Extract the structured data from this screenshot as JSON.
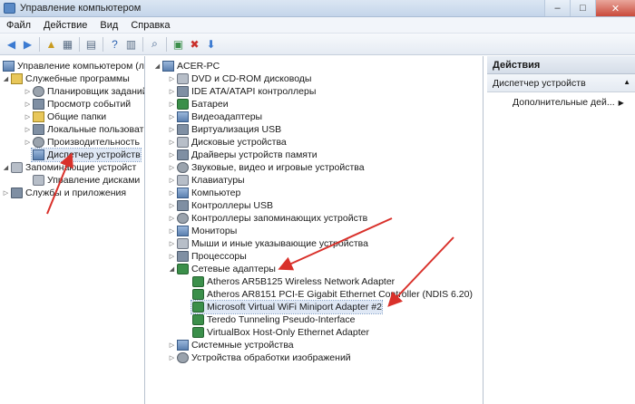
{
  "window": {
    "title": "Управление компьютером",
    "minimize": "–",
    "maximize": "□",
    "close": "✕"
  },
  "menu": [
    "Файл",
    "Действие",
    "Вид",
    "Справка"
  ],
  "left_tree": {
    "root": "Управление компьютером (л",
    "system_tools": "Служебные программы",
    "task_scheduler": "Планировщик заданий",
    "event_viewer": "Просмотр событий",
    "shared_folders": "Общие папки",
    "local_users": "Локальные пользоват",
    "performance": "Производительность",
    "device_manager": "Диспетчер устройств",
    "storage": "Запоминающие устройст",
    "disk_management": "Управление дисками",
    "services_apps": "Службы и приложения"
  },
  "device_tree": {
    "root": "ACER-PC",
    "categories": [
      "DVD и CD-ROM дисководы",
      "IDE ATA/ATAPI контроллеры",
      "Батареи",
      "Видеоадаптеры",
      "Виртуализация USB",
      "Дисковые устройства",
      "Драйверы устройств памяти",
      "Звуковые, видео и игровые устройства",
      "Клавиатуры",
      "Компьютер",
      "Контроллеры USB",
      "Контроллеры запоминающих устройств",
      "Мониторы",
      "Мыши и иные указывающие устройства",
      "Процессоры",
      "Сетевые адаптеры"
    ],
    "network_adapters": [
      "Atheros AR5B125 Wireless Network Adapter",
      "Atheros AR8151 PCI-E Gigabit Ethernet Controller (NDIS 6.20)",
      "Microsoft Virtual WiFi Miniport Adapter #2",
      "Teredo Tunneling Pseudo-Interface",
      "VirtualBox Host-Only Ethernet Adapter"
    ],
    "after": [
      "Системные устройства",
      "Устройства обработки изображений"
    ]
  },
  "actions": {
    "header": "Действия",
    "section": "Диспетчер устройств",
    "more": "Дополнительные дей..."
  },
  "colors": {
    "arrow": "#d9312b",
    "selection": "#dfe8f5"
  }
}
